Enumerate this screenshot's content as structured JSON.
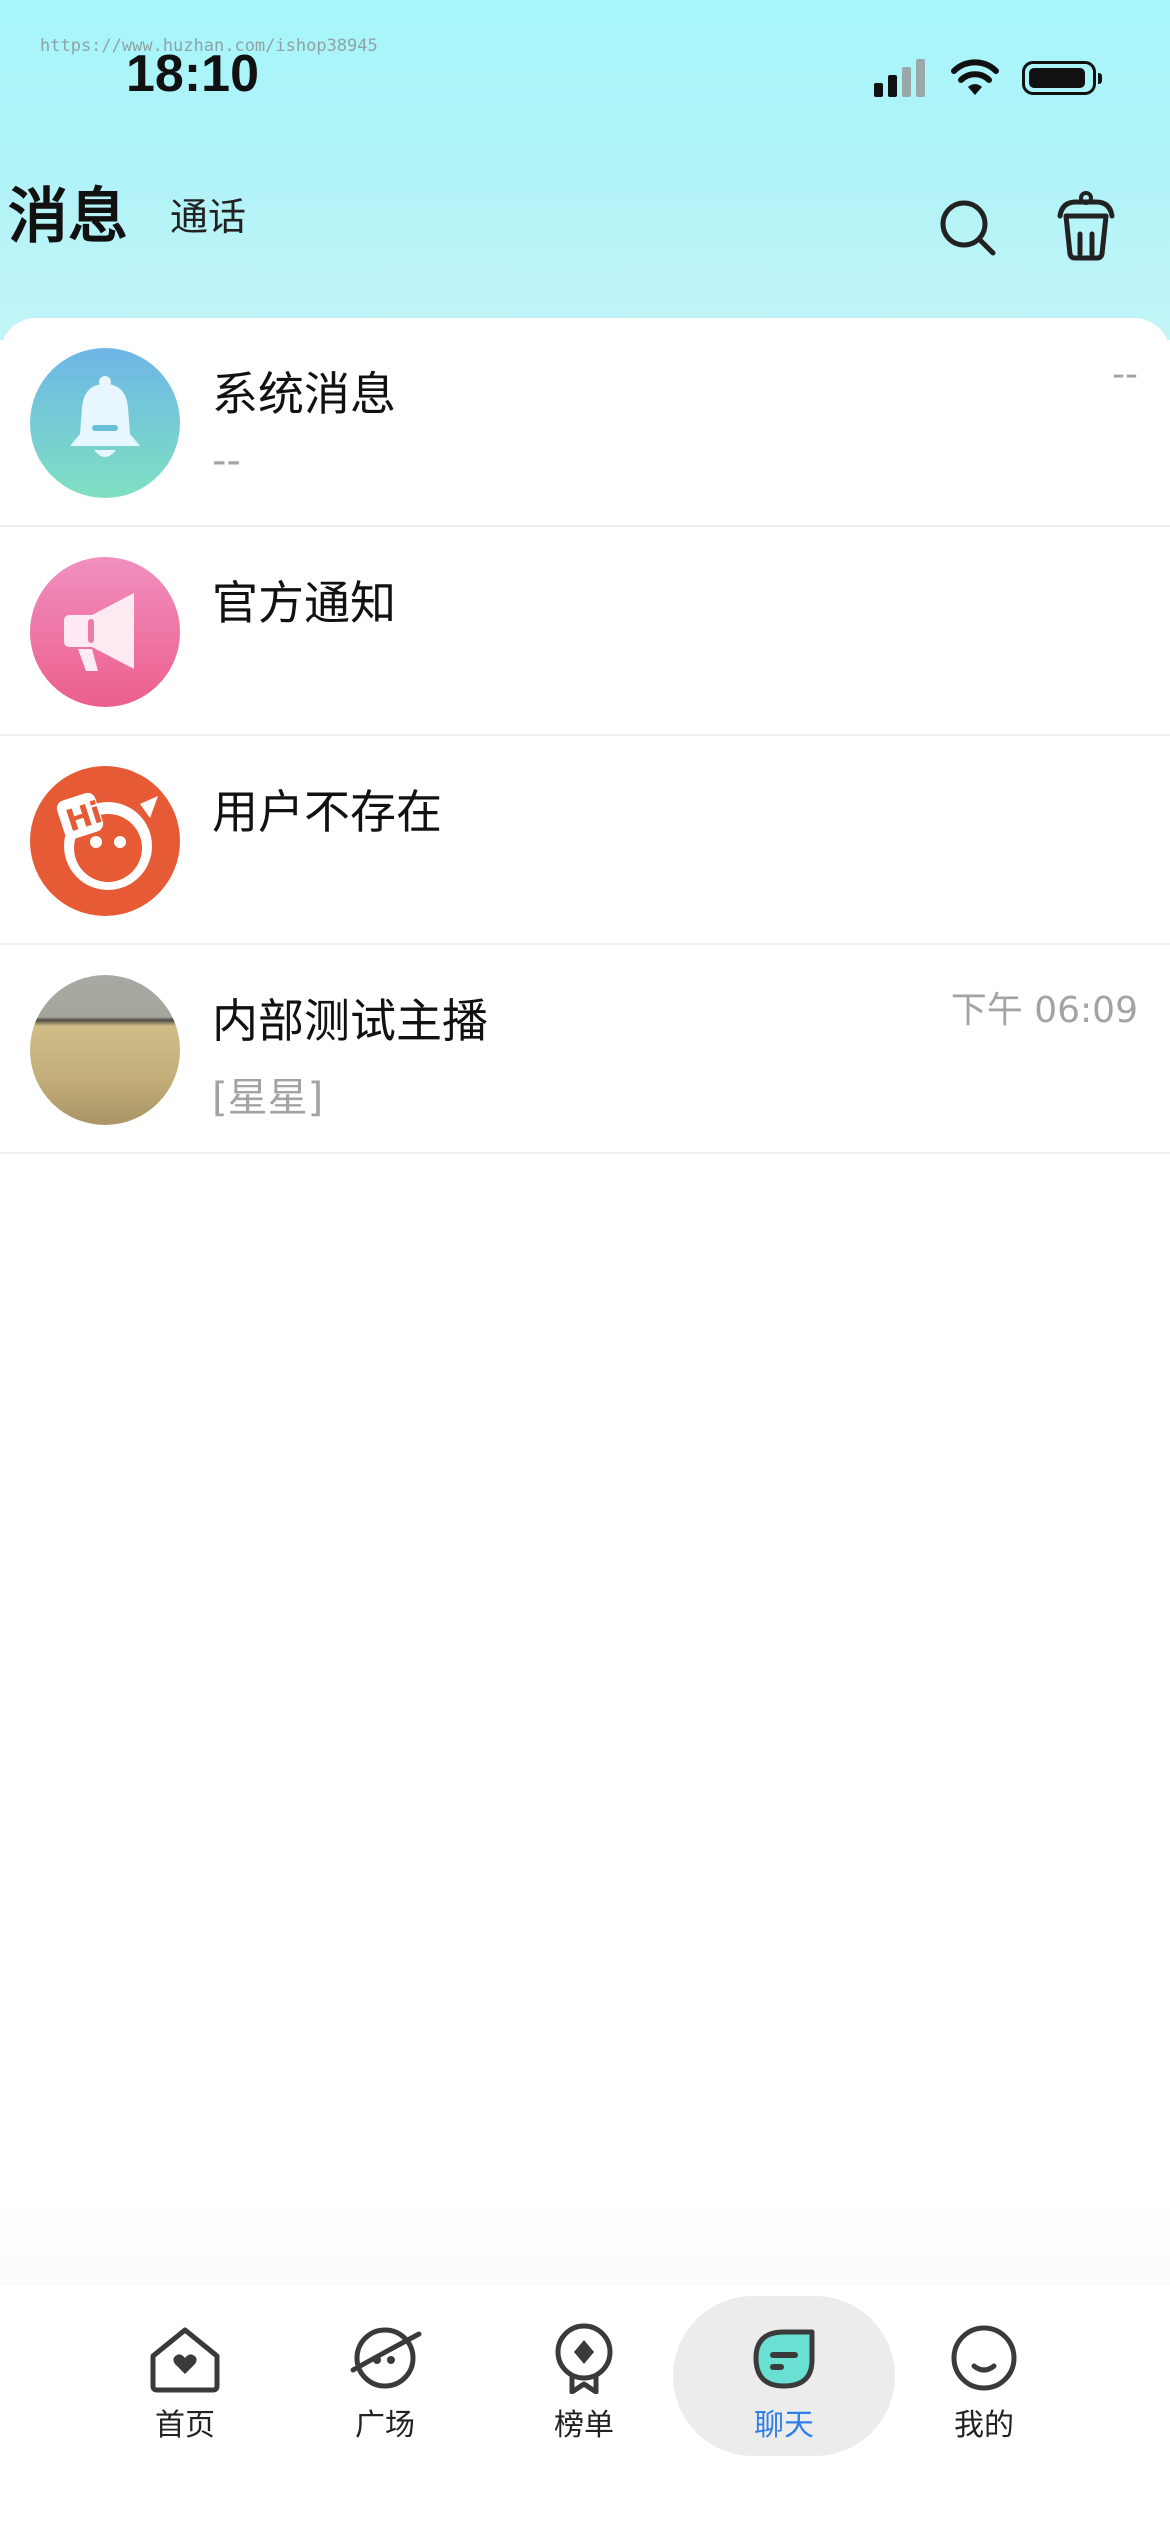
{
  "status_bar": {
    "watermark": "https://www.huzhan.com/ishop38945",
    "time": "18:10",
    "battery_percent": 90,
    "signal_bars_filled": 2,
    "signal_bars_total": 4
  },
  "header": {
    "title": "消息",
    "tab_calls": "通话",
    "icons": [
      "search-icon",
      "trash-bin-icon"
    ],
    "gradient_top": "#a6f6fb"
  },
  "conversations": [
    {
      "name": "系统消息",
      "preview": "--",
      "time": "--",
      "avatar": "bell-icon",
      "avatar_colors": [
        "#6db6e6",
        "#7fe0c2"
      ]
    },
    {
      "name": "官方通知",
      "preview": "",
      "time": "",
      "avatar": "megaphone-icon",
      "avatar_colors": [
        "#f08fbf",
        "#ec5f8c"
      ]
    },
    {
      "name": "用户不存在",
      "preview": "",
      "time": "",
      "avatar": "hi-face-logo",
      "avatar_colors": [
        "#e65b36",
        "#e65b36"
      ]
    },
    {
      "name": "内部测试主播",
      "preview": "[星星]",
      "time": "下午 06:09",
      "avatar": "photo-avatar",
      "avatar_colors": [
        "#a9a9a0",
        "#c7b47e"
      ]
    }
  ],
  "bottom_nav": {
    "items": [
      {
        "label": "首页",
        "icon": "home-icon"
      },
      {
        "label": "广场",
        "icon": "planet-icon"
      },
      {
        "label": "榜单",
        "icon": "rank-badge-icon"
      },
      {
        "label": "聊天",
        "icon": "chat-icon"
      },
      {
        "label": "我的",
        "icon": "profile-face-icon"
      }
    ],
    "active_index": 3,
    "active_color": "#2f7fe8"
  }
}
